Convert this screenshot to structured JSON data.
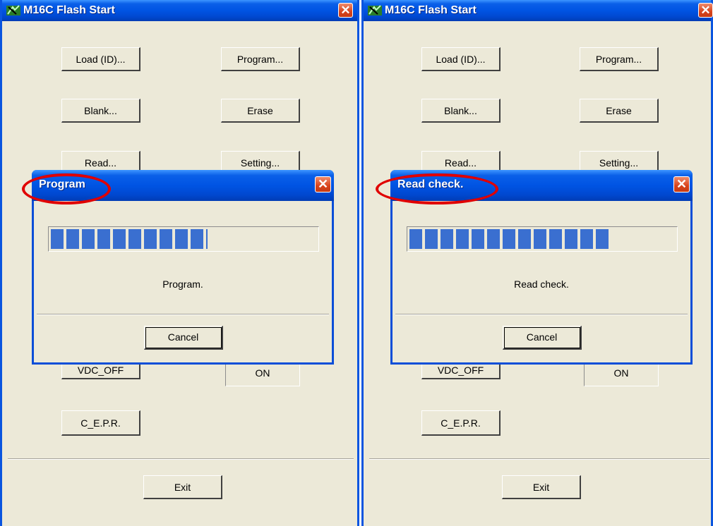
{
  "windows": [
    {
      "title": "M16C Flash Start",
      "buttons": {
        "load": "Load (ID)...",
        "program": "Program...",
        "blank": "Blank...",
        "erase": "Erase",
        "read": "Read...",
        "setting": "Setting...",
        "vdc_off": "VDC_OFF",
        "on": "ON",
        "cepr": "C_E.P.R.",
        "exit": "Exit"
      },
      "dialog": {
        "title": "Program",
        "message": "Program.",
        "cancel": "Cancel",
        "progress": 0.59,
        "close": "✕"
      },
      "close": "✕"
    },
    {
      "title": "M16C Flash Start",
      "buttons": {
        "load": "Load (ID)...",
        "program": "Program...",
        "blank": "Blank...",
        "erase": "Erase",
        "read": "Read...",
        "setting": "Setting...",
        "vdc_off": "VDC_OFF",
        "on": "ON",
        "cepr": "C_E.P.R.",
        "exit": "Exit"
      },
      "dialog": {
        "title": "Read check.",
        "message": "Read check.",
        "cancel": "Cancel",
        "progress": 0.76,
        "close": "✕"
      },
      "close": "✕"
    }
  ],
  "colors": {
    "titlebar": "#0054e3",
    "window_bg": "#ece9d8",
    "progress": "#3a6fd0",
    "highlight": "#e00000"
  },
  "icons": [
    "app-icon",
    "close-icon",
    "progress-bar"
  ]
}
